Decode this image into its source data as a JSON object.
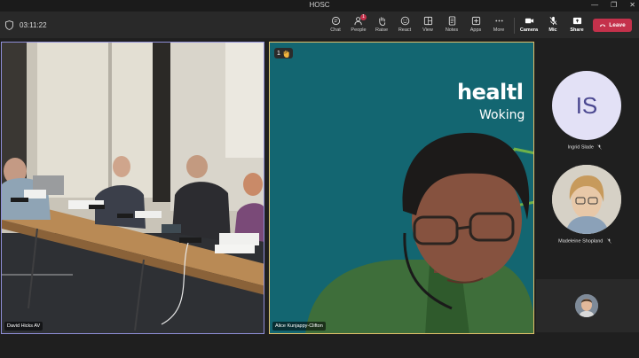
{
  "window": {
    "title": "HOSC",
    "minimize": "—",
    "maximize": "❐",
    "close": "✕"
  },
  "meeting": {
    "timer": "03:11:22"
  },
  "toolbar": {
    "chat": "Chat",
    "people": "People",
    "people_badge": "1",
    "raise": "Raise",
    "react": "React",
    "view": "View",
    "notes": "Notes",
    "apps": "Apps",
    "more": "More",
    "camera": "Camera",
    "mic": "Mic",
    "share": "Share",
    "leave": "Leave"
  },
  "tiles": {
    "left": {
      "name": "David Hicks AV"
    },
    "right": {
      "name": "Alice Kunjappy-Clifton",
      "raised_hand_count": "1",
      "logo_word": "healtl",
      "logo_sub": "Woking"
    }
  },
  "roster": [
    {
      "initials": "IS",
      "name": "Ingrid Slade",
      "avatar_color": "#e3e1f6",
      "initials_color": "#4a4790"
    },
    {
      "name": "Madeleine Shopland"
    }
  ],
  "colors": {
    "leave": "#c4314b",
    "accent_purple": "#8f8fd8",
    "accent_gold": "#e2c06a",
    "teal": "#136671"
  }
}
